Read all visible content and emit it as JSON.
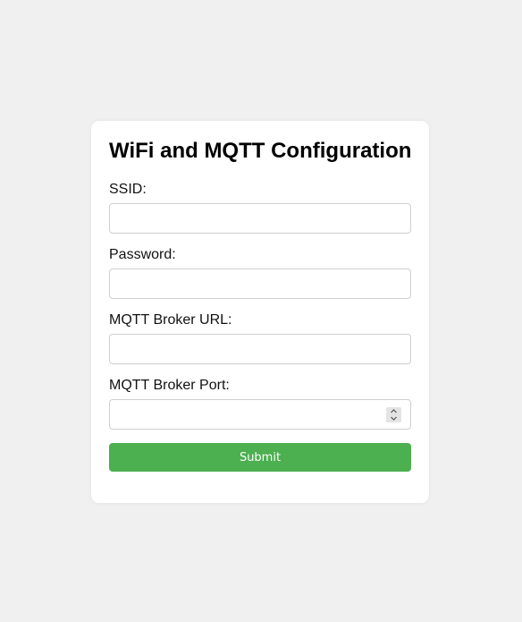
{
  "form": {
    "title": "WiFi and MQTT Configuration",
    "fields": [
      {
        "label": "SSID:",
        "value": "",
        "placeholder": ""
      },
      {
        "label": "Password:",
        "value": "",
        "placeholder": ""
      },
      {
        "label": "MQTT Broker URL:",
        "value": "",
        "placeholder": ""
      },
      {
        "label": "MQTT Broker Port:",
        "value": "",
        "placeholder": ""
      }
    ],
    "submit_label": "Submit"
  },
  "icons": {
    "stepper": "spin-stepper-icon"
  },
  "colors": {
    "background": "#f0f0f0",
    "card": "#ffffff",
    "submit": "#4caf50",
    "submit_text": "#ffffff"
  }
}
